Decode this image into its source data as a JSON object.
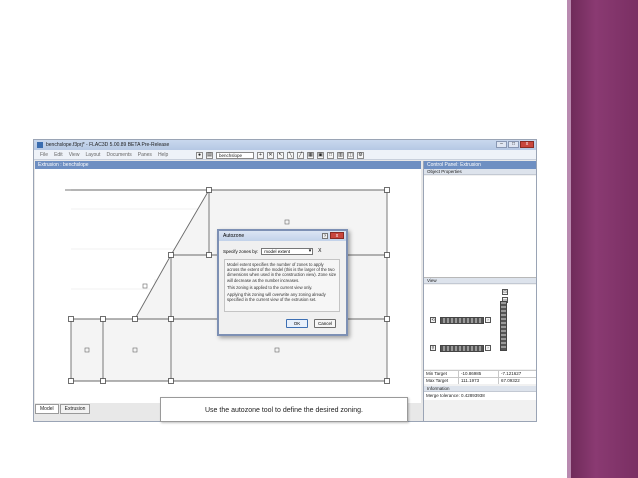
{
  "window": {
    "title": "benchslope.f3prj* - FLAC3D 5.00.89 BETA Pre-Release",
    "controls": [
      "–",
      "□",
      "x"
    ]
  },
  "menu": [
    "File",
    "Edit",
    "View",
    "Layout",
    "Documents",
    "Panes",
    "Help"
  ],
  "toolbar": {
    "selected_model": "benchslope"
  },
  "pane": {
    "title": "Extrusion : benchslope"
  },
  "bottom_tabs": [
    "Model",
    "Extrusion"
  ],
  "caption": "Use the autozone tool to define the desired zoning.",
  "control_panel": {
    "title": "Control Panel: Extrusion",
    "object_properties": "Object Properties",
    "view_label": "View",
    "min_target_label": "Min Target",
    "min_target_value": "-10.86985",
    "min_target_value2": "-7.121627",
    "max_target_label": "Max Target",
    "max_target_value": "111.1973",
    "max_target_value2": "67.09322",
    "information_label": "Information",
    "merge_tolerance": "Merge tolerance: 0.42893938"
  },
  "dialog": {
    "title": "Autozone",
    "help": "?",
    "close": "x",
    "specify_label": "Specify zones by:",
    "specify_value": "model extent",
    "x_symbol": "X",
    "paragraphs": [
      "Model extent specifies the number of zones to apply across the extent of the model (this is the larger of the two dimensions when used in the construction view). Zone size will decrease as the number increases.",
      "This zoning is applied to the current view only.",
      "Applying this zoning will overwrite any zoning already specified in the current view of the extrusion set."
    ],
    "ok_label": "OK",
    "cancel_label": "Cancel"
  },
  "colors": {
    "slide_band": "#7a2f63",
    "pane_header": "#6e8fc2",
    "close_button": "#c9463d"
  }
}
